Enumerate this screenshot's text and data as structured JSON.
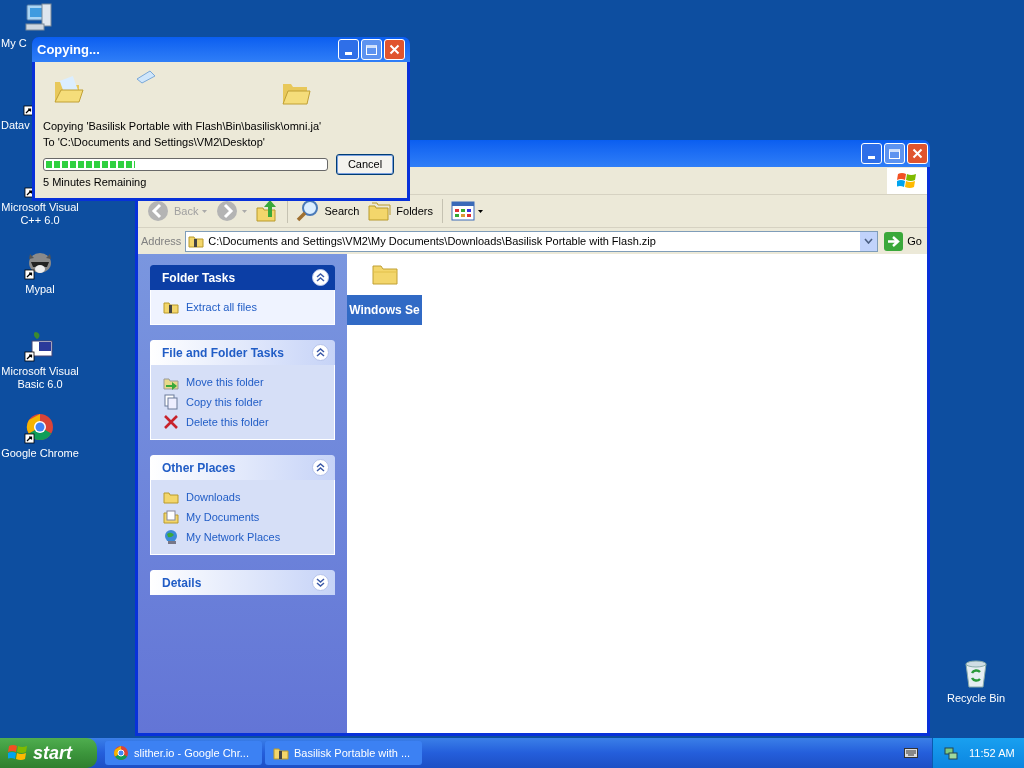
{
  "desktop_icons": [
    {
      "label": "My C",
      "kind": "computer"
    },
    {
      "label": "Datav",
      "kind": "app"
    },
    {
      "label": "Microsoft Visual C++ 6.0",
      "kind": "vc"
    },
    {
      "label": "Mypal",
      "kind": "raccoon"
    },
    {
      "label": "Microsoft Visual Basic 6.0",
      "kind": "vb"
    },
    {
      "label": "Google Chrome",
      "kind": "chrome"
    },
    {
      "label": "Recycle Bin",
      "kind": "recycle"
    }
  ],
  "explorer": {
    "toolbar": [
      {
        "kind": "back",
        "label": "Back",
        "disabled": true
      },
      {
        "kind": "forward",
        "disabled": true
      },
      {
        "kind": "up",
        "disabled": false
      },
      {
        "kind": "search",
        "label": "Search",
        "disabled": false
      },
      {
        "kind": "folders",
        "label": "Folders",
        "disabled": false
      },
      {
        "kind": "views",
        "disabled": false
      }
    ],
    "address": {
      "label": "Address",
      "value": "C:\\Documents and Settings\\VM2\\My Documents\\Downloads\\Basilisk Portable with Flash.zip"
    },
    "go": "Go",
    "task_panels": [
      {
        "title": "Folder Tasks",
        "kind": "special",
        "expanded": true,
        "items": [
          {
            "label": "Extract all files",
            "kind": "zip"
          }
        ]
      },
      {
        "title": "File and Folder Tasks",
        "kind": "normal",
        "expanded": true,
        "items": [
          {
            "label": "Move this folder",
            "kind": "move"
          },
          {
            "label": "Copy this folder",
            "kind": "copy"
          },
          {
            "label": "Delete this folder",
            "kind": "delete"
          }
        ]
      },
      {
        "title": "Other Places",
        "kind": "normal",
        "expanded": true,
        "items": [
          {
            "label": "Downloads",
            "kind": "folder"
          },
          {
            "label": "My Documents",
            "kind": "documents"
          },
          {
            "label": "My Network Places",
            "kind": "network"
          }
        ]
      },
      {
        "title": "Details",
        "kind": "normal",
        "expanded": false
      }
    ],
    "files": [
      {
        "name": "Windows Se",
        "selected": true
      }
    ]
  },
  "dialog": {
    "title": "Copying...",
    "line1": "Copying 'Basilisk Portable with Flash\\Bin\\basilisk\\omni.ja'",
    "line2": "To 'C:\\Documents and Settings\\VM2\\Desktop'",
    "progress": {
      "level": 0.32
    },
    "remaining": "5 Minutes Remaining",
    "cancel": "Cancel"
  },
  "taskbar": {
    "start": "start",
    "tasks": [
      {
        "label": "slither.io - Google Chr...",
        "kind": "chrome"
      },
      {
        "label": "Basilisk Portable with ...",
        "kind": "zip"
      }
    ],
    "clock": "11:52 AM"
  }
}
